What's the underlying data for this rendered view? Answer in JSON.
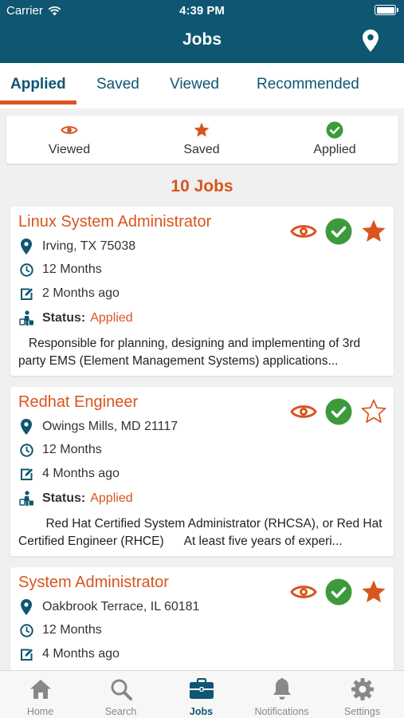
{
  "status_bar": {
    "carrier": "Carrier",
    "time": "4:39 PM"
  },
  "header": {
    "title": "Jobs"
  },
  "tabs": [
    {
      "label": "Applied",
      "active": true
    },
    {
      "label": "Saved"
    },
    {
      "label": "Viewed"
    },
    {
      "label": "Recommended"
    }
  ],
  "filters": [
    {
      "label": "Viewed",
      "icon": "eye-icon"
    },
    {
      "label": "Saved",
      "icon": "star-icon"
    },
    {
      "label": "Applied",
      "icon": "check-circle-icon"
    }
  ],
  "jobs_count": "10 Jobs",
  "jobs": [
    {
      "title": "Linux System Administrator",
      "location": "Irving, TX 75038",
      "duration": "12 Months",
      "posted": "2 Months ago",
      "status_label": "Status:",
      "status": "Applied",
      "description": "   Responsible for planning, designing and implementing of 3rd party EMS (Element Management Systems) applications...",
      "viewed": true,
      "applied": true,
      "saved": true
    },
    {
      "title": "Redhat Engineer",
      "location": "Owings Mills, MD 21117",
      "duration": "12 Months",
      "posted": "4 Months ago",
      "status_label": "Status:",
      "status": "Applied",
      "description": "        Red Hat Certified System Administrator (RHCSA), or Red Hat Certified Engineer (RHCE)      At least five years of experi...",
      "viewed": true,
      "applied": true,
      "saved": false
    },
    {
      "title": "System Administrator",
      "location": "Oakbrook Terrace, IL 60181",
      "duration": "12 Months",
      "posted": "4 Months ago",
      "viewed": true,
      "applied": true,
      "saved": true
    }
  ],
  "tabbar": [
    {
      "label": "Home",
      "icon": "home-icon"
    },
    {
      "label": "Search",
      "icon": "search-icon"
    },
    {
      "label": "Jobs",
      "icon": "briefcase-icon",
      "active": true
    },
    {
      "label": "Notifications",
      "icon": "bell-icon"
    },
    {
      "label": "Settings",
      "icon": "gear-icon"
    }
  ],
  "colors": {
    "primary": "#0e5672",
    "accent": "#d9541e",
    "success": "#3c9a3c",
    "inactive": "#888888"
  }
}
